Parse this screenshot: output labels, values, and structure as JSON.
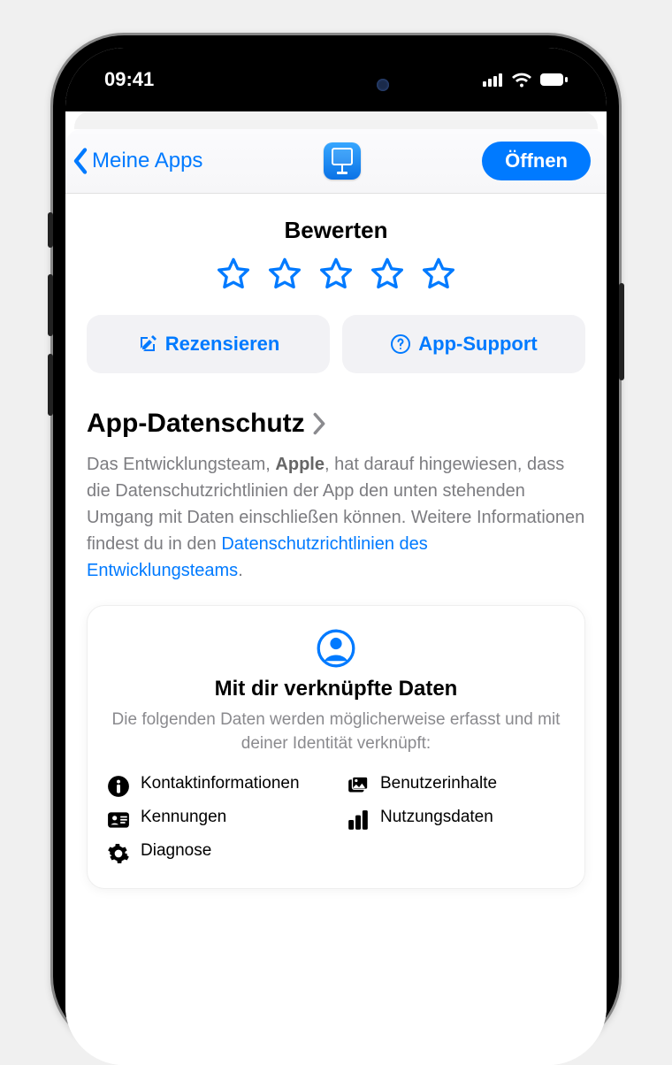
{
  "status": {
    "time": "09:41"
  },
  "nav": {
    "back_label": "Meine Apps",
    "open_label": "Öffnen"
  },
  "rating": {
    "title": "Bewerten"
  },
  "actions": {
    "review": "Rezensieren",
    "support": "App-Support"
  },
  "privacy": {
    "heading": "App-Datenschutz",
    "text_1": "Das Entwicklungsteam, ",
    "developer": "Apple",
    "text_2": ", hat darauf hingewie­sen, dass die Datenschutzrichtlinien der App den unten stehenden Umgang mit Daten einschließen können. Weitere Informationen findest du in den ",
    "link": "Datenschutzrichtlinien des Entwicklungsteams",
    "period": "."
  },
  "linked": {
    "title": "Mit dir verknüpfte Daten",
    "subtitle": "Die folgenden Daten werden möglicherweise erfasst und mit deiner Identität verknüpft:",
    "items": {
      "contact": "Kontaktinforma­tionen",
      "content": "Benutzerinhalte",
      "ids": "Kennungen",
      "usage": "Nutzungsdaten",
      "diag": "Diagnose"
    }
  }
}
